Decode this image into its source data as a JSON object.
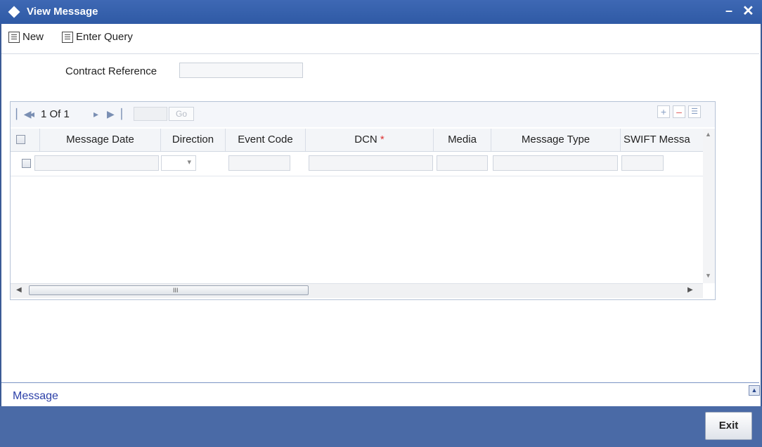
{
  "window": {
    "title": "View Message"
  },
  "toolbar": {
    "new_label": "New",
    "enter_query_label": "Enter Query"
  },
  "form": {
    "contract_reference_label": "Contract Reference",
    "contract_reference_value": ""
  },
  "grid": {
    "pager_text": "1 Of 1",
    "go_label": "Go",
    "columns": [
      "Message Date",
      "Direction",
      "Event Code",
      "DCN",
      "Media",
      "Message Type",
      "SWIFT Messa"
    ],
    "required_mark": "*",
    "scroll_grip": "III"
  },
  "footer": {
    "message_link": "Message",
    "exit_label": "Exit"
  }
}
